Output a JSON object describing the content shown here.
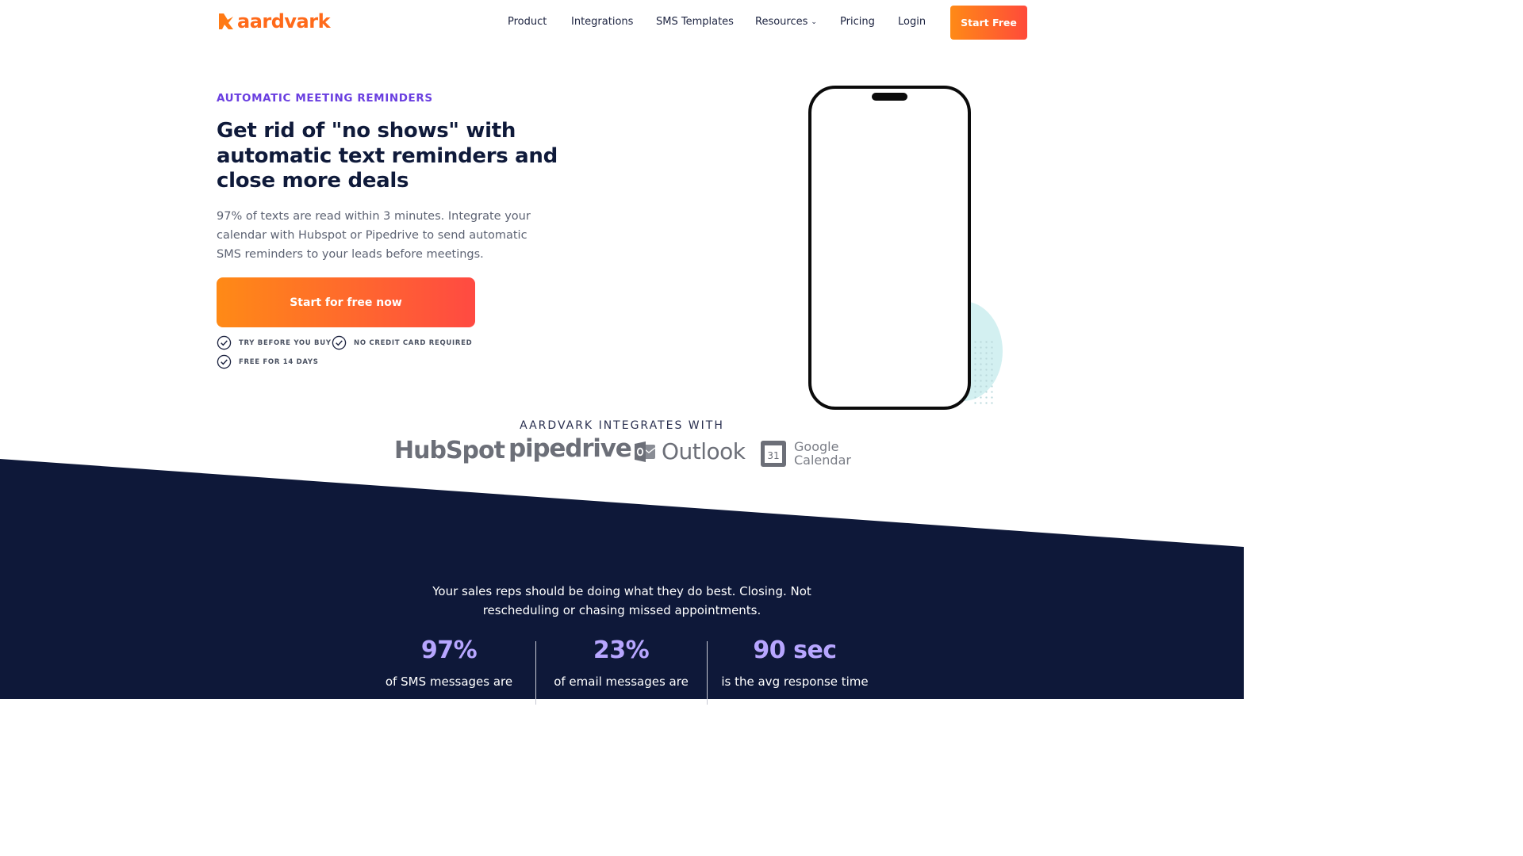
{
  "brand": {
    "name": "aardvark",
    "color": "#ff6a1a"
  },
  "nav": {
    "items": [
      {
        "label": "Product"
      },
      {
        "label": "Integrations"
      },
      {
        "label": "SMS Templates"
      },
      {
        "label": "Resources",
        "has_dropdown": true
      },
      {
        "label": "Pricing"
      },
      {
        "label": "Login"
      }
    ],
    "cta": "Start Free"
  },
  "hero": {
    "eyebrow": "AUTOMATIC MEETING REMINDERS",
    "title": "Get rid of \"no shows\" with automatic text reminders and close more deals",
    "subtitle": "97% of texts are read within 3 minutes. Integrate your calendar with Hubspot or Pipedrive to send automatic SMS reminders to your leads before meetings.",
    "cta": "Start for free now",
    "perks": [
      "TRY BEFORE YOU BUY",
      "NO CREDIT CARD REQUIRED",
      "FREE FOR 14 DAYS"
    ]
  },
  "integrations": {
    "label": "AARDVARK INTEGRATES WITH",
    "logos": {
      "hubspot": "HubSpot",
      "pipedrive": "pipedrive",
      "outlook": "Outlook",
      "google_calendar_line1": "Google",
      "google_calendar_line2": "Calendar",
      "google_calendar_day": "31"
    }
  },
  "value_section": {
    "tagline": "Your sales reps should be doing what they do best. Closing. Not rescheduling or chasing missed appointments.",
    "stats": [
      {
        "value": "97%",
        "desc": "of SMS messages are"
      },
      {
        "value": "23%",
        "desc": "of email messages are"
      },
      {
        "value": "90 sec",
        "desc": "is the avg response time"
      }
    ]
  },
  "colors": {
    "accent_gradient_start": "#ff8a16",
    "accent_gradient_end": "#ff4a3a",
    "eyebrow": "#6a3fe0",
    "navy": "#0f1a3a",
    "stat_number": "#b7a6ff"
  }
}
